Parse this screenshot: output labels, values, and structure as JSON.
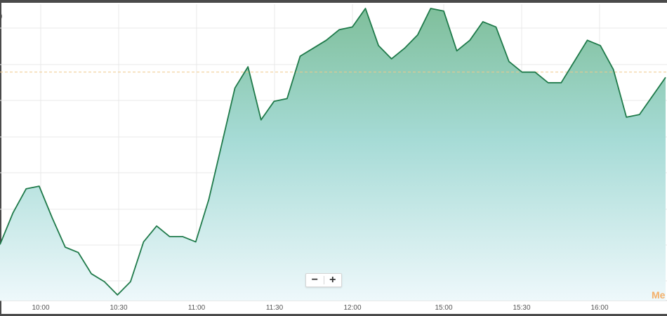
{
  "chart_data": {
    "type": "area",
    "title": "",
    "xlabel": "",
    "ylabel": "",
    "grid": true,
    "reference_line": {
      "style": "dashed",
      "color": "#f0c98a"
    },
    "x_tick_labels": [
      "10:00",
      "10:30",
      "11:00",
      "11:30",
      "12:00",
      "15:00",
      "15:30",
      "16:00"
    ],
    "series": [
      {
        "values": [
          0.15,
          0.27,
          0.36,
          0.37,
          0.25,
          0.14,
          0.12,
          0.04,
          0.01,
          -0.04,
          0.01,
          0.16,
          0.22,
          0.18,
          0.18,
          0.16,
          0.32,
          0.53,
          0.74,
          0.82,
          0.62,
          0.69,
          0.7,
          0.86,
          0.89,
          0.92,
          0.96,
          0.97,
          1.04,
          0.9,
          0.85,
          0.89,
          0.94,
          1.04,
          1.03,
          0.88,
          0.92,
          0.99,
          0.97,
          0.84,
          0.8,
          0.8,
          0.76,
          0.76,
          0.84,
          0.92,
          0.9,
          0.81,
          0.63,
          0.64,
          0.71,
          0.78
        ],
        "color": "#1f7a4a"
      }
    ],
    "reference_value": 0.8,
    "ylim": [
      -0.04,
      1.04
    ]
  },
  "zoom": {
    "minus_label": "−",
    "plus_label": "+"
  },
  "watermark": "Me",
  "top_glyph": ")",
  "colors": {
    "line": "#1f7a4a",
    "fill_top": "#7fbf9b",
    "fill_mid": "#a6dbd6",
    "fill_bottom": "#eef8fb",
    "grid": "#e9e9e9",
    "reference": "#f0c98a",
    "watermark": "#f4b06a"
  }
}
